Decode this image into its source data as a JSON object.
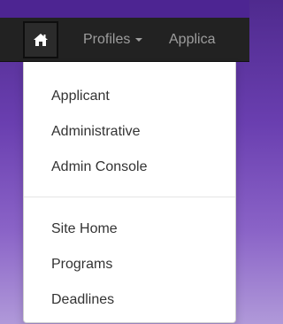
{
  "navbar": {
    "home_icon": "home-icon",
    "profiles_label": "Profiles",
    "profiles_caret_icon": "caret-down-icon",
    "next_item_label": "Applica"
  },
  "dropdown": {
    "group1": [
      "Applicant",
      "Administrative",
      "Admin Console"
    ],
    "group2": [
      "Site Home",
      "Programs",
      "Deadlines"
    ]
  },
  "colors": {
    "navbar_bg": "#222222",
    "nav_text": "#9d9d9d",
    "dropdown_bg": "#ffffff",
    "dropdown_text": "#333333",
    "page_accent": "#5a2ea0"
  }
}
